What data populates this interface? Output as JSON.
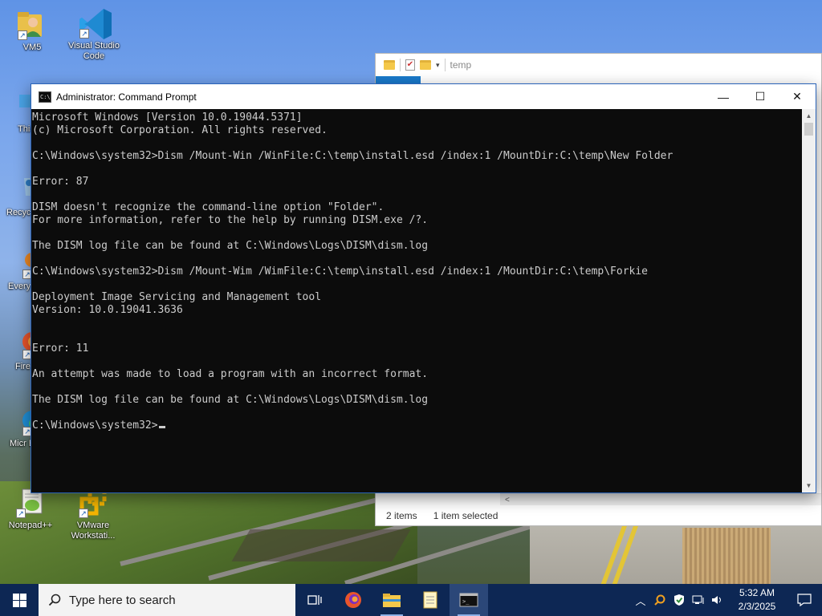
{
  "desktop": {
    "icons": [
      {
        "label": "VM5"
      },
      {
        "label": "Visual Studio Code"
      },
      {
        "label": "This"
      },
      {
        "label": "Recycl"
      },
      {
        "label": "Every"
      },
      {
        "label": "Fire"
      },
      {
        "label": "Micr Ed"
      },
      {
        "label": "Notepad++"
      },
      {
        "label": "VMware Workstati..."
      }
    ]
  },
  "explorer": {
    "path": "temp",
    "status": {
      "items": "2 items",
      "selected": "1 item selected"
    }
  },
  "cmd": {
    "title": "Administrator: Command Prompt",
    "icon_text": "C:\\",
    "controls": {
      "minimize": "—",
      "maximize": "☐",
      "close": "✕"
    },
    "lines": [
      "Microsoft Windows [Version 10.0.19044.5371]",
      "(c) Microsoft Corporation. All rights reserved.",
      "",
      "C:\\Windows\\system32>Dism /Mount-Win /WinFile:C:\\temp\\install.esd /index:1 /MountDir:C:\\temp\\New Folder",
      "",
      "Error: 87",
      "",
      "DISM doesn't recognize the command-line option \"Folder\".",
      "For more information, refer to the help by running DISM.exe /?.",
      "",
      "The DISM log file can be found at C:\\Windows\\Logs\\DISM\\dism.log",
      "",
      "C:\\Windows\\system32>Dism /Mount-Wim /WimFile:C:\\temp\\install.esd /index:1 /MountDir:C:\\temp\\Forkie",
      "",
      "Deployment Image Servicing and Management tool",
      "Version: 10.0.19041.3636",
      "",
      "",
      "Error: 11",
      "",
      "An attempt was made to load a program with an incorrect format.",
      "",
      "The DISM log file can be found at C:\\Windows\\Logs\\DISM\\dism.log",
      "",
      "C:\\Windows\\system32>"
    ]
  },
  "taskbar": {
    "search_placeholder": "Type here to search",
    "clock": {
      "time": "5:32 AM",
      "date": "2/3/2025"
    },
    "accent": "#0d2754"
  }
}
